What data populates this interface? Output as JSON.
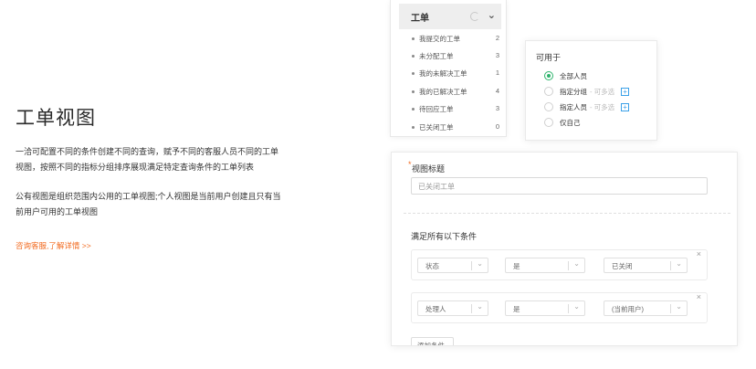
{
  "intro": {
    "title": "工单视图",
    "desc1": "一洽可配置不同的条件创建不同的查询，赋予不同的客服人员不同的工单视图，按照不同的指标分组排序展现满足特定查询条件的工单列表",
    "desc2": "公有视图是组织范围内公用的工单视图;个人视图是当前用户创建且只有当前用户可用的工单视图",
    "link": "咨询客服,了解详情 >>"
  },
  "ticket_list": {
    "header": "工单",
    "items": [
      {
        "label": "我提交的工单",
        "count": "2"
      },
      {
        "label": "未分配工单",
        "count": "3"
      },
      {
        "label": "我的未解决工单",
        "count": "1"
      },
      {
        "label": "我的已解决工单",
        "count": "4"
      },
      {
        "label": "待回应工单",
        "count": "3"
      },
      {
        "label": "已关闭工单",
        "count": "0"
      }
    ]
  },
  "available_to": {
    "title": "可用于",
    "options": [
      {
        "label": "全部人员",
        "hint": "",
        "selected": true
      },
      {
        "label": "指定分组",
        "hint": "- 可多选",
        "selected": false
      },
      {
        "label": "指定人员",
        "hint": "- 可多选",
        "selected": false
      },
      {
        "label": "仅自己",
        "hint": "",
        "selected": false
      }
    ]
  },
  "form": {
    "required_mark": "*",
    "view_title_label": "视图标题",
    "view_title_value": "已关闭工单",
    "conditions_title": "满足所有以下条件",
    "conditions": [
      {
        "field": "状态",
        "operator": "是",
        "value": "已关闭"
      },
      {
        "field": "处理人",
        "operator": "是",
        "value": "(当前用户)"
      }
    ],
    "add_condition": "添加条件"
  },
  "colors": {
    "accent_orange": "#f26b21",
    "radio_green": "#2db36b",
    "plus_blue": "#3aa0e8"
  }
}
